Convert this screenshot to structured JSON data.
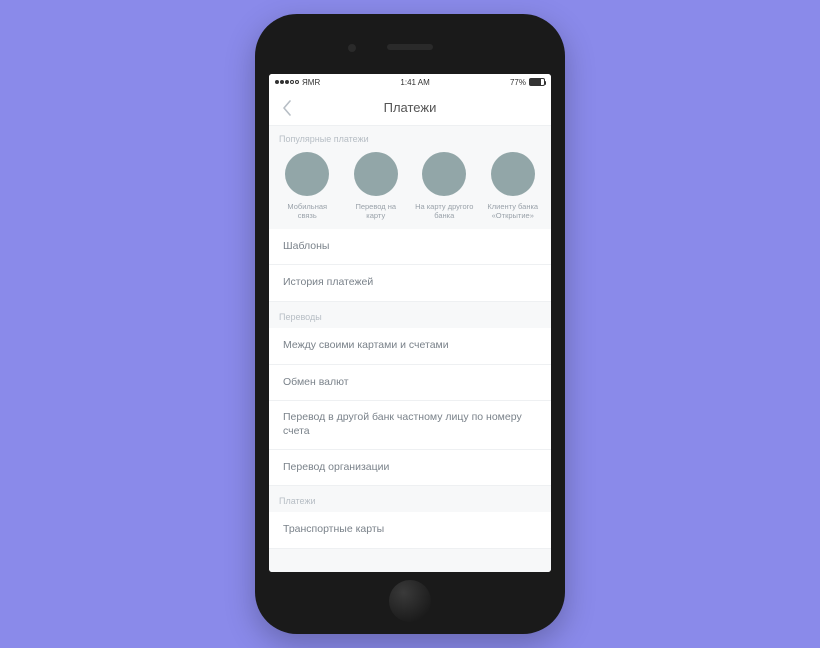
{
  "status_bar": {
    "carrier": "ЯMR",
    "time": "1:41 AM",
    "battery_pct": "77%"
  },
  "nav": {
    "title": "Платежи"
  },
  "popular": {
    "label": "Популярные платежи",
    "items": [
      {
        "label": "Мобильная связь"
      },
      {
        "label": "Перевод на карту"
      },
      {
        "label": "На карту другого банка"
      },
      {
        "label": "Клиенту банка «Открытие»"
      }
    ]
  },
  "quick_list": {
    "items": [
      {
        "label": "Шаблоны"
      },
      {
        "label": "История платежей"
      }
    ]
  },
  "transfers": {
    "header": "Переводы",
    "items": [
      {
        "label": "Между своими картами и счетами"
      },
      {
        "label": "Обмен валют"
      },
      {
        "label": "Перевод в другой банк частному лицу по номеру счета"
      },
      {
        "label": "Перевод организации"
      }
    ]
  },
  "payments": {
    "header": "Платежи",
    "items": [
      {
        "label": "Транспортные карты"
      }
    ]
  }
}
